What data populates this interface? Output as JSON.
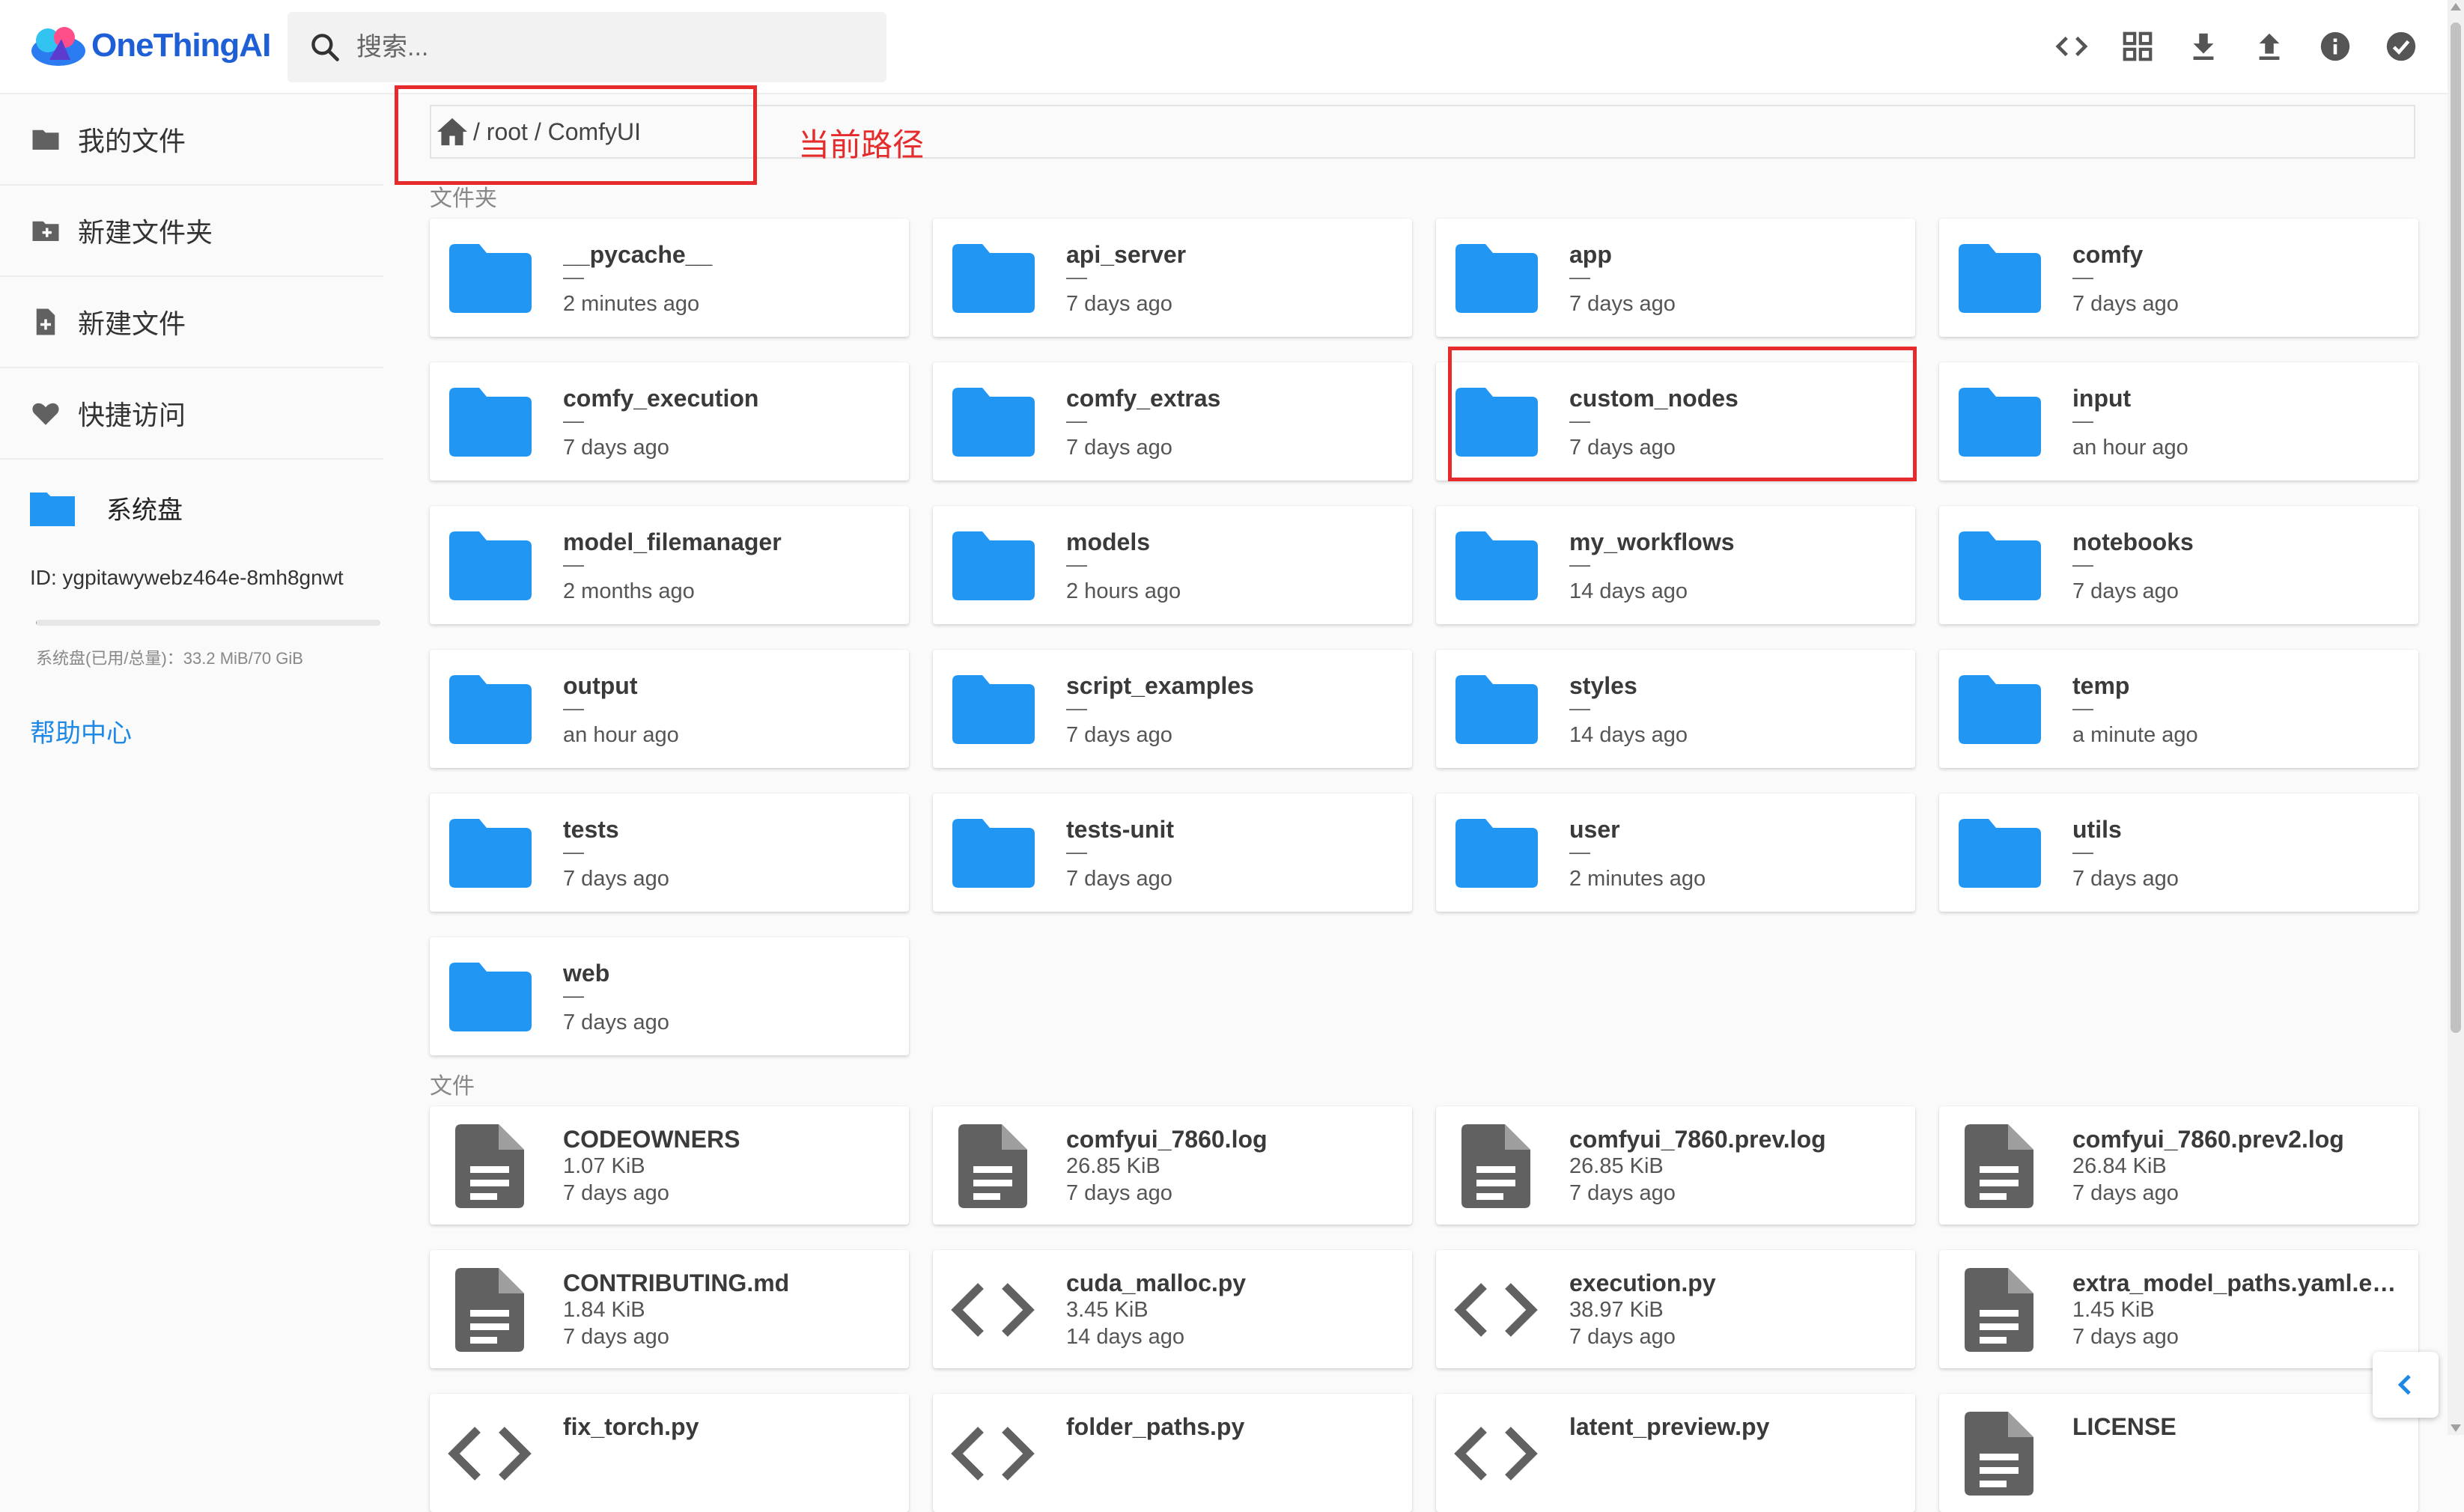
{
  "brand": {
    "name": "OneThingAI"
  },
  "search": {
    "placeholder": "搜索..."
  },
  "toolbar": {
    "icons": [
      "code-view-icon",
      "grid-view-icon",
      "download-icon",
      "upload-icon",
      "info-icon",
      "select-all-icon"
    ]
  },
  "sidebar": {
    "items": [
      {
        "label": "我的文件",
        "icon": "folder-icon"
      },
      {
        "label": "新建文件夹",
        "icon": "new-folder-icon"
      },
      {
        "label": "新建文件",
        "icon": "new-file-icon"
      },
      {
        "label": "快捷访问",
        "icon": "heart-icon"
      }
    ],
    "disk_label": "系统盘",
    "id_text": "ID: ygpitawywebz464e-8mh8gnwt",
    "usage_text": "系统盘(已用/总量)：33.2 MiB/70 GiB",
    "usage_fraction": 0.0005,
    "help_label": "帮助中心"
  },
  "breadcrumb": {
    "path": "/ root / ComfyUI"
  },
  "annotation": {
    "label": "当前路径",
    "color": "#e52b2b"
  },
  "sections": {
    "folders_label": "文件夹",
    "files_label": "文件"
  },
  "folders": [
    {
      "name": "__pycache__",
      "dash": "—",
      "date": "2 minutes ago"
    },
    {
      "name": "api_server",
      "dash": "—",
      "date": "7 days ago"
    },
    {
      "name": "app",
      "dash": "—",
      "date": "7 days ago"
    },
    {
      "name": "comfy",
      "dash": "—",
      "date": "7 days ago"
    },
    {
      "name": "comfy_execution",
      "dash": "—",
      "date": "7 days ago"
    },
    {
      "name": "comfy_extras",
      "dash": "—",
      "date": "7 days ago"
    },
    {
      "name": "custom_nodes",
      "dash": "—",
      "date": "7 days ago"
    },
    {
      "name": "input",
      "dash": "—",
      "date": "an hour ago"
    },
    {
      "name": "model_filemanager",
      "dash": "—",
      "date": "2 months ago"
    },
    {
      "name": "models",
      "dash": "—",
      "date": "2 hours ago"
    },
    {
      "name": "my_workflows",
      "dash": "—",
      "date": "14 days ago"
    },
    {
      "name": "notebooks",
      "dash": "—",
      "date": "7 days ago"
    },
    {
      "name": "output",
      "dash": "—",
      "date": "an hour ago"
    },
    {
      "name": "script_examples",
      "dash": "—",
      "date": "7 days ago"
    },
    {
      "name": "styles",
      "dash": "—",
      "date": "14 days ago"
    },
    {
      "name": "temp",
      "dash": "—",
      "date": "a minute ago"
    },
    {
      "name": "tests",
      "dash": "—",
      "date": "7 days ago"
    },
    {
      "name": "tests-unit",
      "dash": "—",
      "date": "7 days ago"
    },
    {
      "name": "user",
      "dash": "—",
      "date": "2 minutes ago"
    },
    {
      "name": "utils",
      "dash": "—",
      "date": "7 days ago"
    },
    {
      "name": "web",
      "dash": "—",
      "date": "7 days ago"
    }
  ],
  "files": [
    {
      "name": "CODEOWNERS",
      "size": "1.07 KiB",
      "date": "7 days ago",
      "icon": "file-icon"
    },
    {
      "name": "comfyui_7860.log",
      "size": "26.85 KiB",
      "date": "7 days ago",
      "icon": "file-icon"
    },
    {
      "name": "comfyui_7860.prev.log",
      "size": "26.85 KiB",
      "date": "7 days ago",
      "icon": "file-icon"
    },
    {
      "name": "comfyui_7860.prev2.log",
      "size": "26.84 KiB",
      "date": "7 days ago",
      "icon": "file-icon"
    },
    {
      "name": "CONTRIBUTING.md",
      "size": "1.84 KiB",
      "date": "7 days ago",
      "icon": "file-icon"
    },
    {
      "name": "cuda_malloc.py",
      "size": "3.45 KiB",
      "date": "14 days ago",
      "icon": "code-icon"
    },
    {
      "name": "execution.py",
      "size": "38.97 KiB",
      "date": "7 days ago",
      "icon": "code-icon"
    },
    {
      "name": "extra_model_paths.yaml.exa...",
      "size": "1.45 KiB",
      "date": "7 days ago",
      "icon": "file-icon"
    },
    {
      "name": "fix_torch.py",
      "size": "",
      "date": "",
      "icon": "code-icon"
    },
    {
      "name": "folder_paths.py",
      "size": "",
      "date": "",
      "icon": "code-icon"
    },
    {
      "name": "latent_preview.py",
      "size": "",
      "date": "",
      "icon": "code-icon"
    },
    {
      "name": "LICENSE",
      "size": "",
      "date": "",
      "icon": "file-icon"
    }
  ]
}
